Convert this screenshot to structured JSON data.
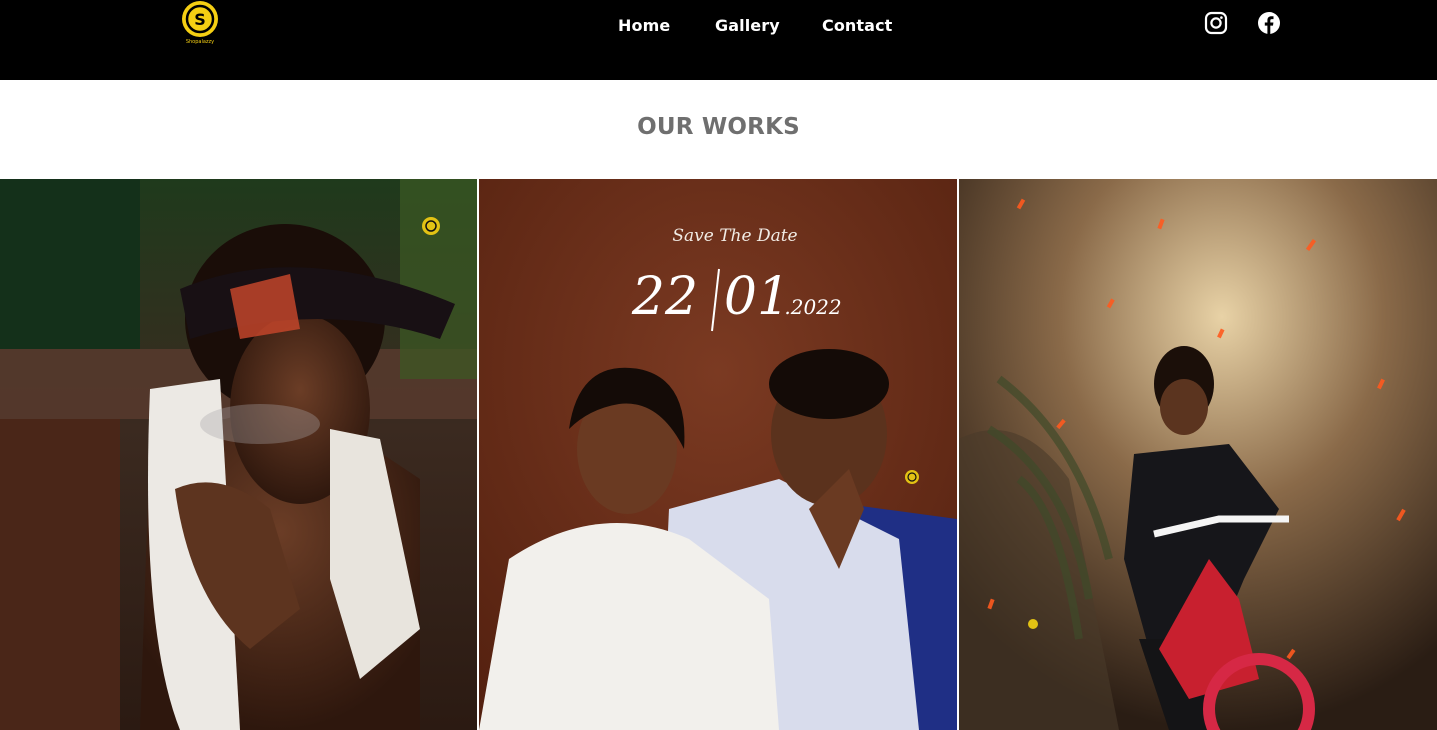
{
  "header": {
    "logo_alt": "Shopalazzy logo",
    "logo_text": "Shopalazzy",
    "nav": [
      {
        "label": "Home"
      },
      {
        "label": "Gallery"
      },
      {
        "label": "Contact"
      }
    ],
    "social": [
      {
        "icon": "instagram-icon"
      },
      {
        "icon": "facebook-icon"
      }
    ]
  },
  "section": {
    "title": "OUR WORKS"
  },
  "gallery": {
    "tiles": [
      {
        "alt": "Portrait of a man with bandana and towel smoking"
      },
      {
        "alt": "Couple engagement photo",
        "overlay_heading": "Save The Date",
        "overlay_day": "22",
        "overlay_month": "01",
        "overlay_year": ".2022"
      },
      {
        "alt": "Child on a red bicycle with sparks background"
      }
    ]
  },
  "colors": {
    "header_bg": "#000000",
    "logo_yellow": "#f5cf13",
    "title_gray": "#6f6f6f",
    "tile2_bg": "#6b2f1c"
  }
}
